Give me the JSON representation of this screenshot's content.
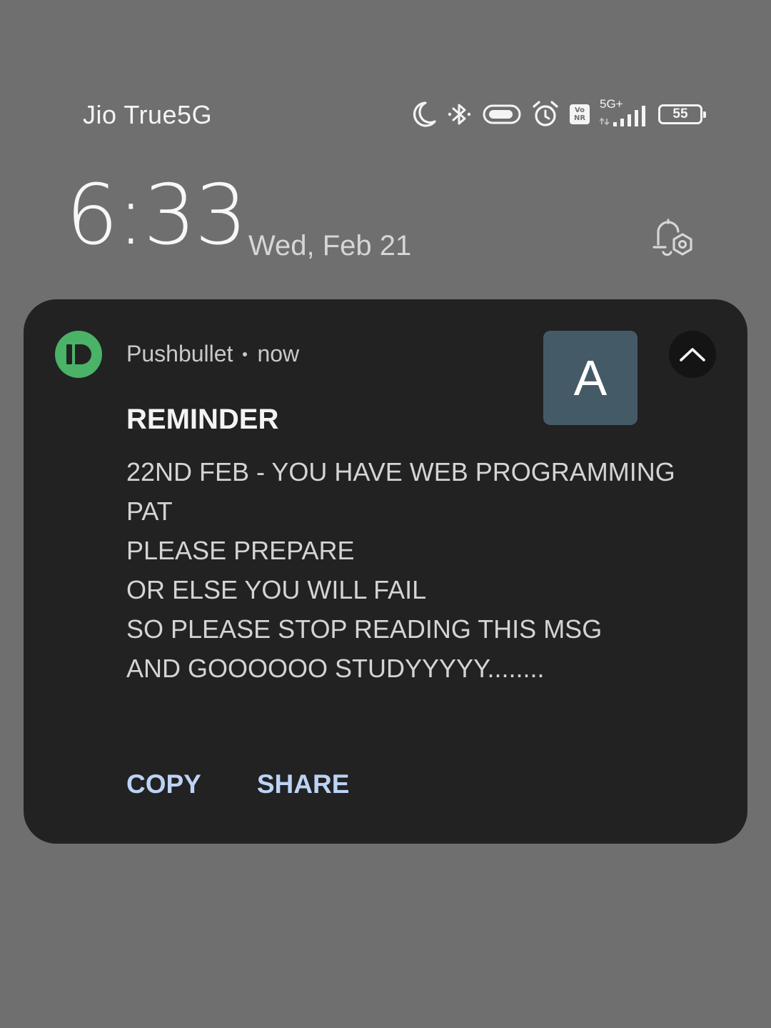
{
  "status_bar": {
    "carrier": "Jio True5G",
    "icons": [
      "moon-icon",
      "bluetooth-icon",
      "headset-battery-icon",
      "alarm-icon",
      "vonr-icon",
      "signal-icon",
      "battery-icon"
    ],
    "vonr_top": "Vo",
    "vonr_bottom": "NR",
    "network_type": "5G+",
    "signal_bars": 4,
    "battery_percent": "55"
  },
  "clock": {
    "time": "6:33",
    "date": "Wed, Feb 21"
  },
  "notification": {
    "app_name": "Pushbullet",
    "time": "now",
    "app_icon_color": "#4ab367",
    "avatar_letter": "A",
    "avatar_color": "#455a67",
    "title": "REMINDER",
    "body_lines": [
      "22ND FEB - YOU HAVE WEB PROGRAMMING",
      "PAT",
      "PLEASE PREPARE",
      "OR ELSE YOU WILL FAIL",
      "SO PLEASE STOP READING THIS MSG",
      "AND GOOOOOO STUDYYYYY........"
    ],
    "actions": [
      "COPY",
      "SHARE"
    ],
    "action_color": "#bcd3f4"
  }
}
